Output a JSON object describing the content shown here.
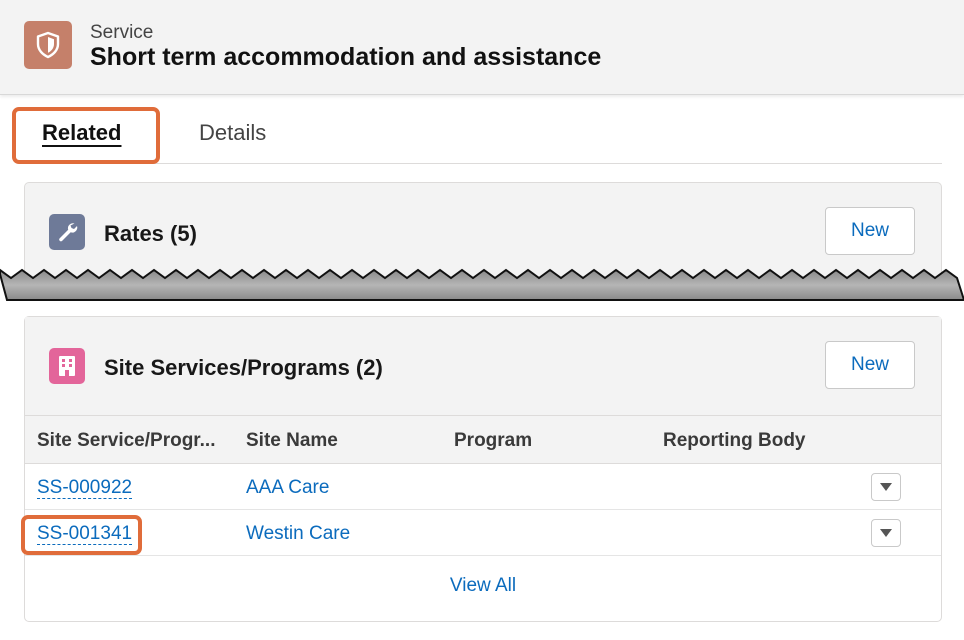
{
  "header": {
    "object_label": "Service",
    "title": "Short term accommodation and assistance",
    "icon": "shield-icon",
    "icon_color": "#c5806a"
  },
  "tabs": [
    {
      "label": "Related",
      "active": true
    },
    {
      "label": "Details",
      "active": false
    }
  ],
  "rates_card": {
    "title": "Rates (5)",
    "icon": "wrench-icon",
    "icon_color": "#6e7a98",
    "new_label": "New"
  },
  "site_card": {
    "title": "Site Services/Programs (2)",
    "icon": "building-icon",
    "icon_color": "#e3659a",
    "new_label": "New",
    "columns": [
      "Site Service/Progr...",
      "Site Name",
      "Program",
      "Reporting Body"
    ],
    "rows": [
      {
        "id": "SS-000922",
        "site_name": "AAA Care",
        "program": "",
        "reporting_body": ""
      },
      {
        "id": "SS-001341",
        "site_name": "Westin Care",
        "program": "",
        "reporting_body": ""
      }
    ],
    "view_all_label": "View All"
  },
  "colors": {
    "link": "#0b6bbd",
    "highlight": "#e06c3a"
  }
}
